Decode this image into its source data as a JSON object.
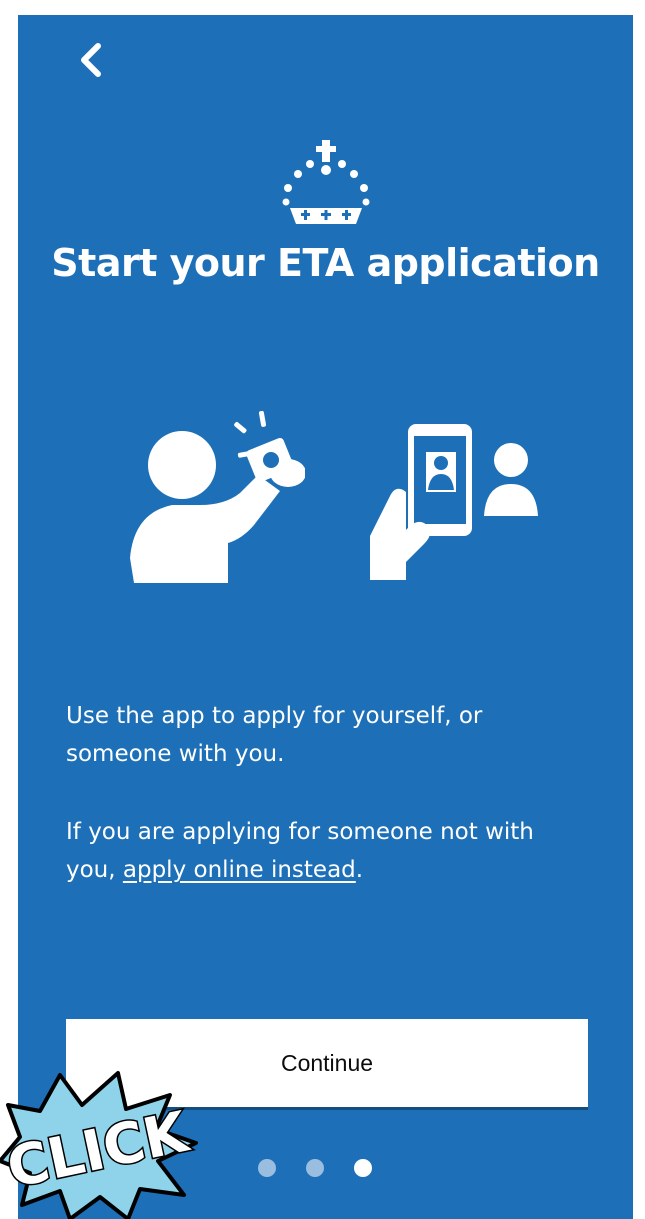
{
  "header": {
    "back_icon": "chevron-left-icon",
    "logo_icon": "crown-icon"
  },
  "main": {
    "title": "Start your ETA application",
    "illustrations": [
      "selfie-camera-icon",
      "phone-photo-person-icon"
    ],
    "paragraph_1": "Use the app to apply for yourself, or someone with you.",
    "paragraph_2_prefix": "If you are applying for someone not with you, ",
    "paragraph_2_link": "apply online instead",
    "paragraph_2_suffix": "."
  },
  "footer": {
    "continue_label": "Continue",
    "pagination": {
      "total": 3,
      "active_index": 2
    }
  },
  "overlay": {
    "sticker_text": "CLICK"
  },
  "colors": {
    "background": "#1d70b8",
    "text": "#ffffff",
    "button_bg": "#ffffff",
    "button_text": "#0b0c0c",
    "sticker_fill": "#8fd3ea"
  }
}
